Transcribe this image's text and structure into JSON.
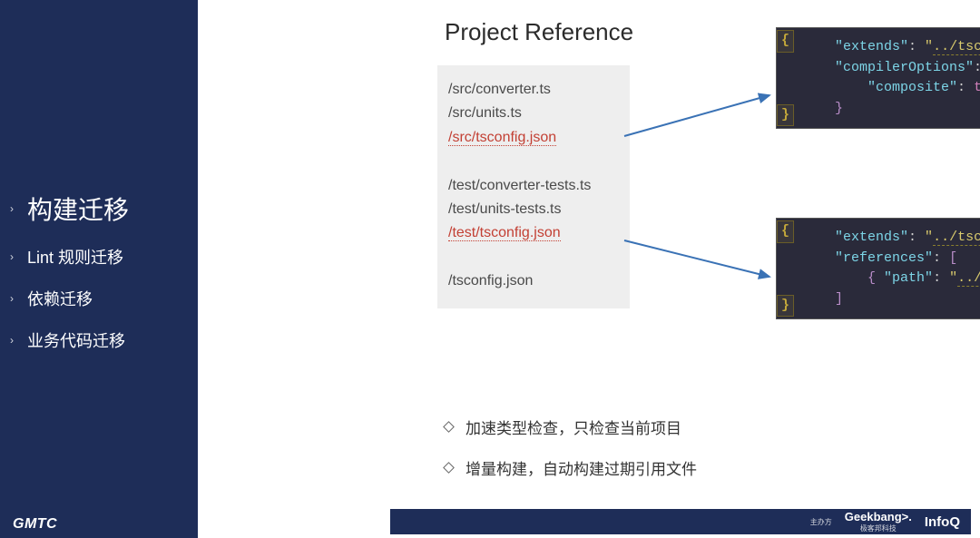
{
  "sidebar": {
    "items": [
      {
        "label": "构建迁移",
        "active": true
      },
      {
        "label": "Lint 规则迁移",
        "active": false
      },
      {
        "label": "依赖迁移",
        "active": false
      },
      {
        "label": "业务代码迁移",
        "active": false
      }
    ],
    "footer": "GMTC"
  },
  "slide": {
    "title": "Project Reference",
    "files": {
      "group1": [
        {
          "text": "/src/converter.ts",
          "highlight": false
        },
        {
          "text": "/src/units.ts",
          "highlight": false
        },
        {
          "text": "/src/tsconfig.json",
          "highlight": true
        }
      ],
      "group2": [
        {
          "text": "/test/converter-tests.ts",
          "highlight": false
        },
        {
          "text": "/test/units-tests.ts",
          "highlight": false
        },
        {
          "text": "/test/tsconfig.json",
          "highlight": true
        }
      ],
      "group3": [
        {
          "text": "/tsconfig.json",
          "highlight": false
        }
      ]
    },
    "code_top": {
      "extends_key": "\"extends\"",
      "extends_val": "\"../tsconfig\"",
      "compiler_key": "\"compilerOptions\"",
      "composite_key": "\"composite\"",
      "composite_val": "true"
    },
    "code_bot": {
      "extends_key": "\"extends\"",
      "extends_val": "\"../tsconfig\"",
      "references_key": "\"references\"",
      "path_key": "\"path\"",
      "path_val": "\"../src\""
    },
    "bullets": [
      "加速类型检查，只检查当前项目",
      "增量构建，自动构建过期引用文件"
    ]
  },
  "footer_right": {
    "host": "主办方",
    "geekbang": "Geekbang>.",
    "sub": "极客邦科技",
    "infoq": "InfoQ"
  }
}
